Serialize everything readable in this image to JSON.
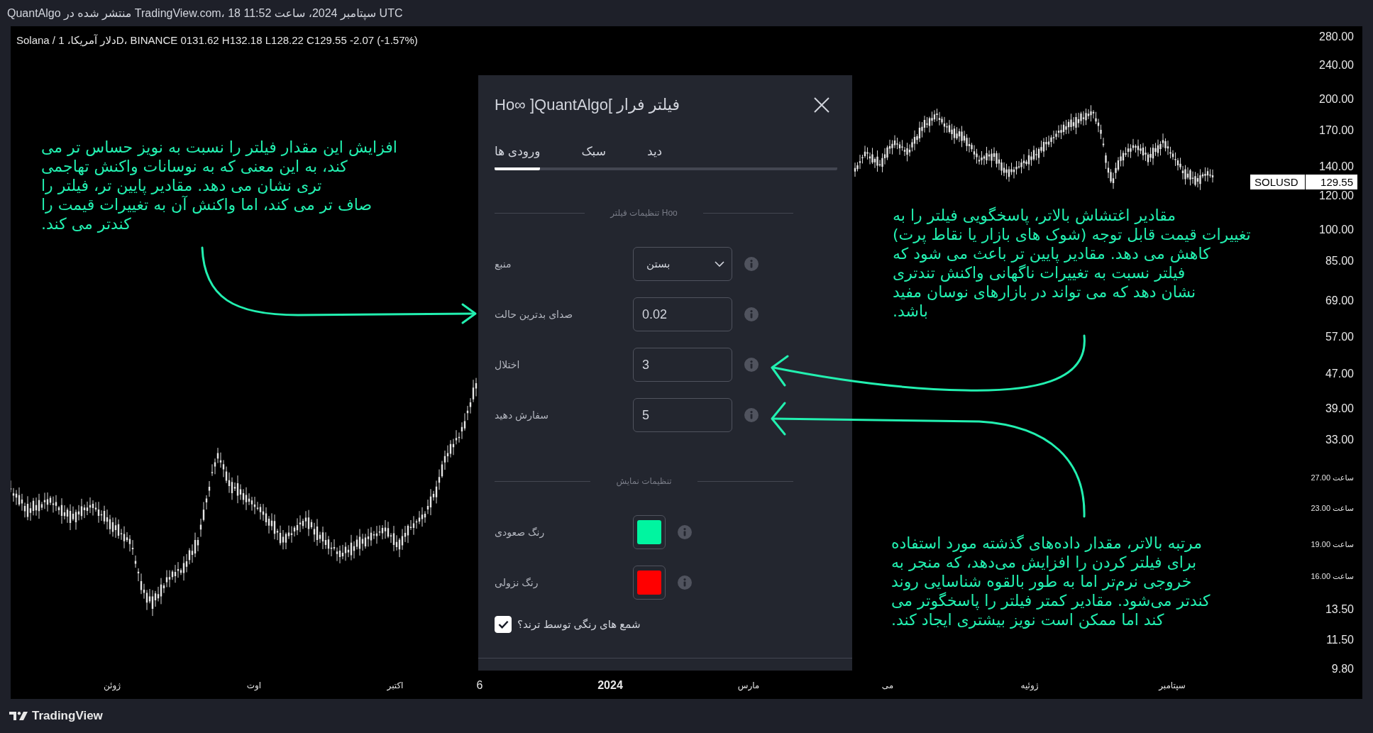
{
  "header": {
    "attribution": "QuantAlgo منتشر شده در TradingView.com، 18 سپتامبر 2024، ساعت 11:52 UTC"
  },
  "chart": {
    "legend": "Solana / دلار آمریکا، 1D، BINANCE 0131.62 H132.18 L128.22 C129.55 -2.07 (-1.57%)",
    "price_axis": {
      "labels": [
        {
          "text": "280.00",
          "kind": "major"
        },
        {
          "text": "240.00",
          "kind": "major"
        },
        {
          "text": "200.00",
          "kind": "major"
        },
        {
          "text": "170.00",
          "kind": "major"
        },
        {
          "text": "140.00",
          "kind": "major"
        },
        {
          "text": "120.00",
          "kind": "major"
        },
        {
          "text": "100.00",
          "kind": "major"
        },
        {
          "text": "85.00",
          "kind": "major"
        },
        {
          "text": "69.00",
          "kind": "major"
        },
        {
          "text": "57.00",
          "kind": "major"
        },
        {
          "text": "47.00",
          "kind": "major"
        },
        {
          "text": "39.00",
          "kind": "major"
        },
        {
          "text": "33.00",
          "kind": "major"
        },
        {
          "text": "ساعت 27.00",
          "kind": "minor"
        },
        {
          "text": "ساعت 23.00",
          "kind": "minor"
        },
        {
          "text": "ساعت 19.00",
          "kind": "minor"
        },
        {
          "text": "ساعت 16.00",
          "kind": "minor"
        },
        {
          "text": "13.50",
          "kind": "major"
        },
        {
          "text": "11.50",
          "kind": "major"
        },
        {
          "text": "9.80",
          "kind": "major"
        }
      ]
    },
    "price_tag": {
      "symbol": "SOLUSD",
      "price": "129.55"
    },
    "time_axis": {
      "labels": [
        {
          "text": "سپتامبر",
          "kind": "month"
        },
        {
          "text": "ژوئیه",
          "kind": "month"
        },
        {
          "text": "می",
          "kind": "month"
        },
        {
          "text": "مارس",
          "kind": "month"
        },
        {
          "text": "2024",
          "kind": "year"
        },
        {
          "text": "6",
          "kind": "day"
        },
        {
          "text": "اکتبر",
          "kind": "month"
        },
        {
          "text": "اوت",
          "kind": "month"
        },
        {
          "text": "ژوئن",
          "kind": "month"
        }
      ]
    }
  },
  "dialog": {
    "title": "Ho∞ ]QuantAlgo[ فیلتر فرار",
    "tabs": [
      {
        "label": "دید",
        "selected": false
      },
      {
        "label": "سبک",
        "selected": false
      },
      {
        "label": "ورودی ها",
        "selected": true
      }
    ],
    "sections": [
      {
        "heading": "تنظیمات فیلتر Hoo",
        "rows": [
          {
            "kind": "select",
            "label": "منبع",
            "value": "بستن"
          },
          {
            "kind": "input",
            "label": "صدای بدترین حالت",
            "value": "0.02"
          },
          {
            "kind": "input",
            "label": "اختلال",
            "value": "3"
          },
          {
            "kind": "input",
            "label": "سفارش دهید",
            "value": "5"
          }
        ]
      },
      {
        "heading": "تنظیمات نمایش",
        "rows": [
          {
            "kind": "color",
            "label": "رنگ صعودی",
            "color": "#00f5a0"
          },
          {
            "kind": "color",
            "label": "رنگ نزولی",
            "color": "#ff0000"
          },
          {
            "kind": "checkbox",
            "label": "شمع های رنگی توسط ترند؟",
            "checked": true
          }
        ]
      }
    ]
  },
  "annotations": [
    {
      "text": "افزایش این مقدار فیلتر را نسبت به نویز حساس تر می\nکند، به این معنی که به نوسانات واکنش تهاجمی\nتری نشان می دهد. مقادیر پایین تر، فیلتر را\nصاف تر می کند، اما واکنش آن به تغییرات قیمت را\nکندتر می کند."
    },
    {
      "text": "مقادیر اغتشاش بالاتر، پاسخگویی فیلتر را به\nتغییرات قیمت قابل توجه (شوک های بازار یا نقاط پرت)\nکاهش می دهد. مقادیر پایین تر باعث می شود که\nفیلتر نسبت به تغییرات ناگهانی واکنش تندتری\nنشان دهد که می تواند در بازارهای نوسان مفید\nباشد."
    },
    {
      "text": "مرتبه بالاتر، مقدار داده‌های گذشته مورد استفاده\nبرای فیلتر کردن را افزایش می‌دهد، که منجر به\nخروجی نرم‌تر اما به طور بالقوه شناسایی روند\nکندتر می‌شود. مقادیر کمتر فیلتر را پاسخگوتر می\nکند اما ممکن است نویز بیشتری ایجاد کند."
    }
  ],
  "footer": {
    "brand": "TradingView"
  }
}
